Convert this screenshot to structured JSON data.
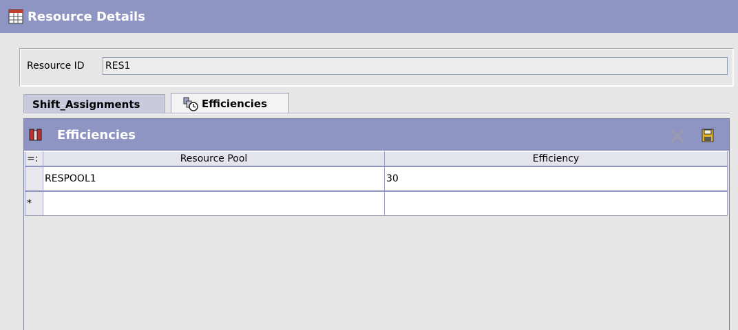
{
  "window": {
    "title": "Resource Details"
  },
  "resource": {
    "id_label": "Resource ID",
    "id_value": "RES1"
  },
  "tabs": [
    {
      "label": "Shift_Assignments",
      "active": false
    },
    {
      "label": "Efficiencies",
      "active": true
    }
  ],
  "panel": {
    "title": "Efficiencies",
    "actions": [
      {
        "name": "delete-icon"
      },
      {
        "name": "save-icon"
      }
    ]
  },
  "table": {
    "row_marker_header": "=:",
    "columns": [
      "Resource Pool",
      "Efficiency"
    ],
    "rows": [
      {
        "marker": "",
        "cells": [
          "RESPOOL1",
          "30"
        ]
      },
      {
        "marker": "*",
        "cells": [
          "",
          ""
        ]
      }
    ]
  },
  "colors": {
    "title_bar": "#8f95c3",
    "background": "#e6e6e6",
    "tab_inactive": "#c9cade"
  }
}
